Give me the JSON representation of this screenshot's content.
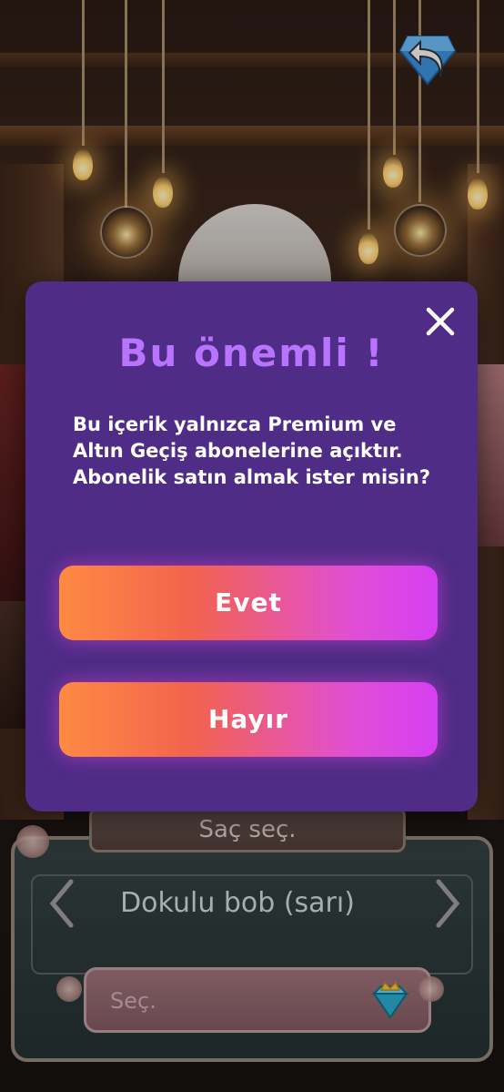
{
  "modal": {
    "title": "Bu önemli !",
    "message": "Bu içerik yalnızca Premium ve Altın Geçiş abonelerine açıktır. Abonelik satın almak ister misin?",
    "yes_label": "Evet",
    "no_label": "Hayır",
    "close_icon": "close-icon"
  },
  "selector": {
    "title": "Saç seç.",
    "current_option": "Dokulu bob (sarı)",
    "select_label": "Seç.",
    "prev_icon": "chevron-left-icon",
    "next_icon": "chevron-right-icon",
    "cost_icon": "crown-gem-icon"
  },
  "header": {
    "back_icon": "back-arrow-icon"
  },
  "colors": {
    "modal_bg": "#4f2c86",
    "title_purple": "#b873ff",
    "button_gradient_start": "#ff8a43",
    "button_gradient_end": "#d53ff2"
  }
}
